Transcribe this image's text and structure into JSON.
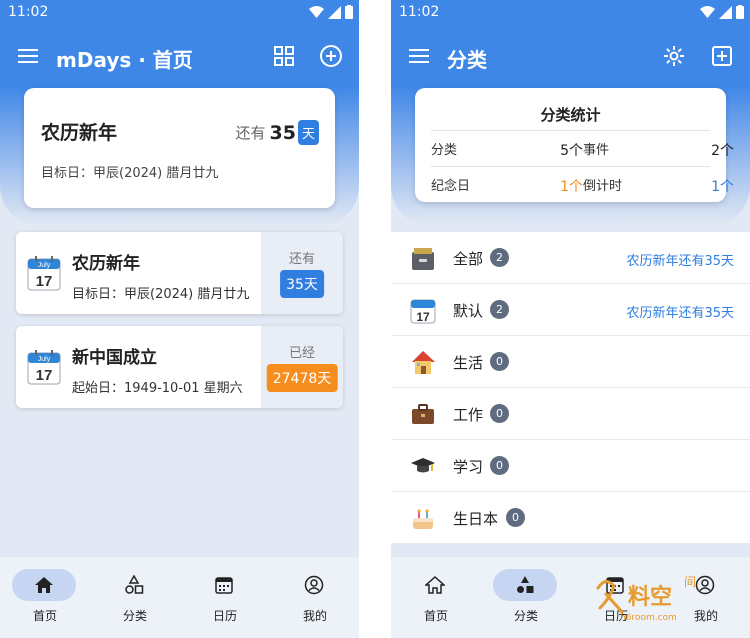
{
  "colors": {
    "primary": "#3f87e7",
    "badge_blue": "#2f7ee0",
    "badge_orange": "#f58d1f",
    "count_gray": "#5f6c80"
  },
  "status": {
    "time": "11:02"
  },
  "home": {
    "title": "mDays · 首页",
    "top_card": {
      "name": "农历新年",
      "prefix": "还有",
      "days": "35",
      "unit": "天",
      "date": "目标日：甲辰(2024) 腊月廿九"
    },
    "events": [
      {
        "name": "农历新年",
        "date": "目标日：甲辰(2024) 腊月廿九",
        "label": "还有",
        "badge": "35天",
        "badge_color": "#2f7ee0",
        "icon": "calendar-icon",
        "cal_month": "July",
        "cal_day": "17"
      },
      {
        "name": "新中国成立",
        "date": "起始日：1949-10-01 星期六",
        "label": "已经",
        "badge": "27478天",
        "badge_color": "#f58d1f",
        "icon": "calendar-icon",
        "cal_month": "July",
        "cal_day": "17"
      }
    ]
  },
  "category": {
    "title": "分类",
    "stats": {
      "title": "分类统计",
      "k1": "分类",
      "v1": "5个",
      "k2": "事件",
      "v2": "2个",
      "k3": "纪念日",
      "v3": "1个",
      "k4": "倒计时",
      "v4": "1个"
    },
    "items": [
      {
        "name": "全部",
        "count": "2",
        "right": "农历新年还有35天",
        "icon": "cabinet-icon"
      },
      {
        "name": "默认",
        "count": "2",
        "right": "农历新年还有35天",
        "icon": "calendar-icon"
      },
      {
        "name": "生活",
        "count": "0",
        "right": "",
        "icon": "house-icon"
      },
      {
        "name": "工作",
        "count": "0",
        "right": "",
        "icon": "briefcase-icon"
      },
      {
        "name": "学习",
        "count": "0",
        "right": "",
        "icon": "graduation-cap-icon"
      },
      {
        "name": "生日本",
        "count": "0",
        "right": "",
        "icon": "cake-icon"
      }
    ]
  },
  "nav": [
    {
      "label": "首页",
      "icon": "home-icon"
    },
    {
      "label": "分类",
      "icon": "shapes-icon"
    },
    {
      "label": "日历",
      "icon": "calendar-grid-icon"
    },
    {
      "label": "我的",
      "icon": "profile-icon"
    }
  ],
  "watermark": {
    "main": "料空",
    "small": "间",
    "url": "h6room.com"
  }
}
